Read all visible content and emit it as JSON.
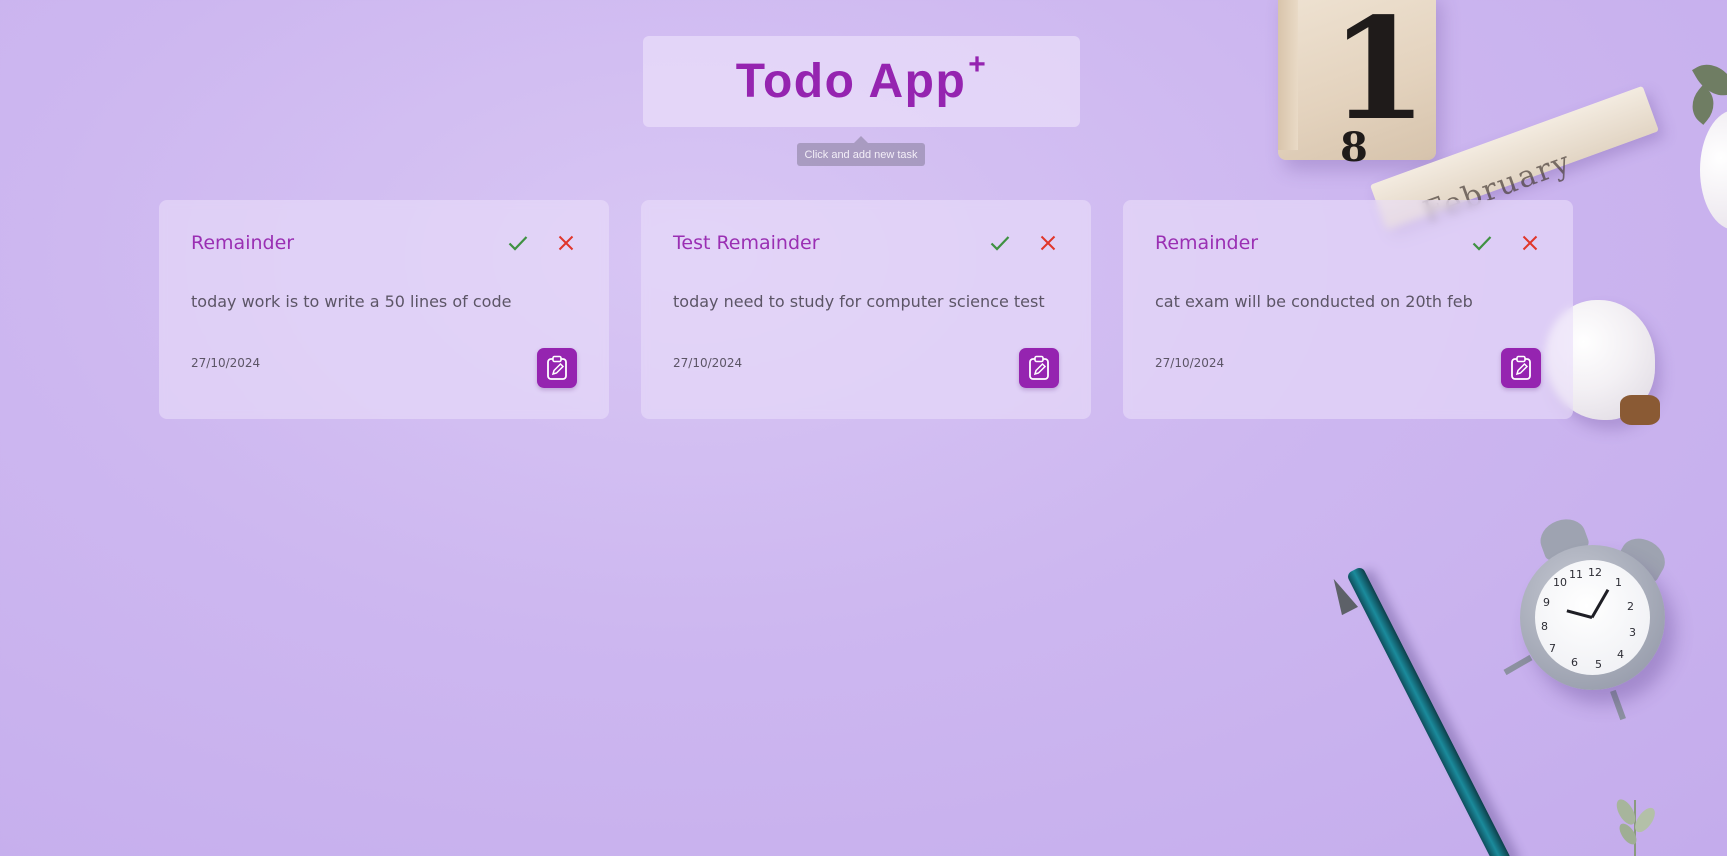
{
  "header": {
    "title": "Todo App",
    "title_sup": "+"
  },
  "tooltip": {
    "text": "Click and add new task"
  },
  "calendar_cube": {
    "digit_top": "1",
    "digit_bottom": "8"
  },
  "calendar_stick": {
    "text": "February"
  },
  "clock": {
    "numbers": [
      "12",
      "1",
      "2",
      "3",
      "4",
      "5",
      "6",
      "7",
      "8",
      "9",
      "10",
      "11"
    ]
  },
  "colors": {
    "accent": "#9524b0",
    "check": "#3f9142",
    "cross": "#e0362b",
    "background": "#cdb7f0"
  },
  "icons": {
    "complete": "check-icon",
    "delete": "close-icon",
    "edit": "clipboard-edit-icon"
  },
  "tasks": [
    {
      "title": "Remainder",
      "description": "today work is to write a 50 lines of code",
      "date": "27/10/2024"
    },
    {
      "title": "Test Remainder",
      "description": "today need to study for computer science test",
      "date": "27/10/2024"
    },
    {
      "title": "Remainder",
      "description": "cat exam will be conducted on 20th feb",
      "date": "27/10/2024"
    }
  ]
}
